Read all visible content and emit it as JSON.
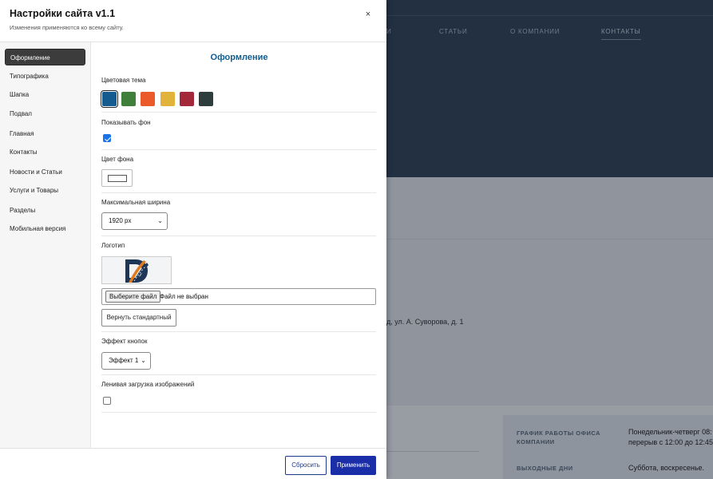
{
  "panel": {
    "title": "Настройки сайта v1.1",
    "subtitle": "Изменения применяются ко всему сайту.",
    "close_glyph": "×"
  },
  "sidebar": {
    "items": [
      {
        "label": "Оформление",
        "active": true
      },
      {
        "label": "Типографика",
        "active": false
      },
      {
        "label": "Шапка",
        "active": false
      },
      {
        "label": "Подвал",
        "active": false
      },
      {
        "label": "Главная",
        "active": false
      },
      {
        "label": "Контакты",
        "active": false
      },
      {
        "label": "Новости и Статьи",
        "active": false
      },
      {
        "label": "Услуги и Товары",
        "active": false
      },
      {
        "label": "Разделы",
        "active": false
      },
      {
        "label": "Мобильная версия",
        "active": false
      }
    ]
  },
  "content": {
    "section_title": "Оформление",
    "color_theme": {
      "label": "Цветовая тема",
      "swatches": [
        {
          "name": "blue",
          "color": "#145b8f",
          "selected": true
        },
        {
          "name": "green",
          "color": "#3f7f3a",
          "selected": false
        },
        {
          "name": "orange",
          "color": "#ea5a2a",
          "selected": false
        },
        {
          "name": "yellow",
          "color": "#e2b33b",
          "selected": false
        },
        {
          "name": "crimson",
          "color": "#a3283a",
          "selected": false
        },
        {
          "name": "dark-slate",
          "color": "#2f3d3d",
          "selected": false
        }
      ]
    },
    "show_background": {
      "label": "Показывать фон",
      "checked": true
    },
    "background_color": {
      "label": "Цвет фона",
      "value": "#ffffff"
    },
    "max_width": {
      "label": "Максимальная ширина",
      "value": "1920 px"
    },
    "logo": {
      "label": "Логотип",
      "file_button": "Выберите файл",
      "file_status": "Файл не выбран",
      "reset_button": "Вернуть стандартный"
    },
    "button_effect": {
      "label": "Эффект кнопок",
      "value": "Эффект 1"
    },
    "lazy_load": {
      "label": "Ленивая загрузка изображений",
      "checked": false
    }
  },
  "footer": {
    "reset_label": "Сбросить",
    "apply_label": "Применить"
  },
  "site": {
    "nav": [
      "И",
      "СТАТЬИ",
      "О КОМПАНИИ",
      "КОНТАКТЫ"
    ],
    "active_nav": "КОНТАКТЫ",
    "address": "д, ул. А. Суворова, д. 1",
    "schedule_label_1": "ГРАФИК РАБОТЫ ОФИСА",
    "schedule_label_2": "КОМПАНИИ",
    "schedule_value_1": "Понедельник-четверг 08:",
    "schedule_value_2": "перерыв с 12:00 до 12:45",
    "days_off_label": "ВЫХОДНЫЕ ДНИ",
    "days_off_value": "Суббота, воскресенье."
  },
  "colors": {
    "accent": "#135c8e",
    "apply_button": "#1a2ea8",
    "site_header": "#344659"
  }
}
